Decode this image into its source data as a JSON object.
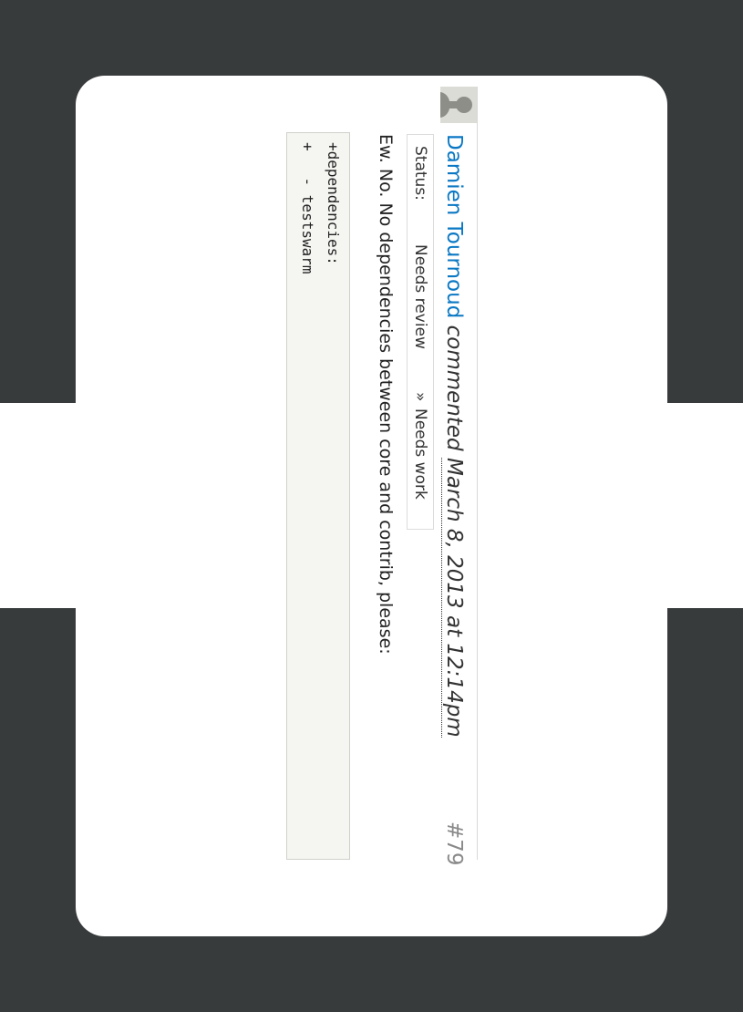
{
  "comment": {
    "author": "Damien Tournoud",
    "action": "commented",
    "date": "March 8, 2013 at 12:14pm",
    "number": "#79",
    "status": {
      "label": "Status:",
      "old": "Needs review",
      "arrow": "»",
      "new": "Needs work"
    },
    "body": "Ew. No. No dependencies between core and contrib, please:",
    "code_lines": [
      "+dependencies:",
      "+   - testswarm"
    ]
  },
  "colors": {
    "background": "#383b3c",
    "card": "#ffffff",
    "link": "#0b78c4",
    "code_bg": "#f5f5f2"
  },
  "icons": {
    "avatar": "default-user-avatar-icon"
  }
}
